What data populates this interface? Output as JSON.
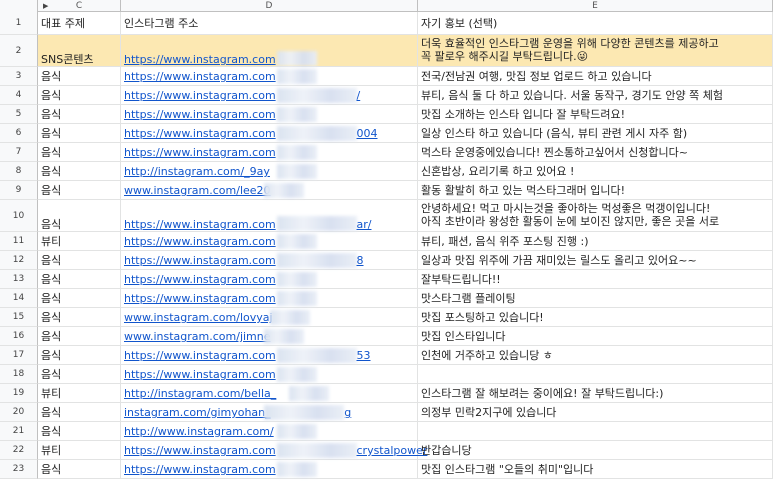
{
  "columns": [
    "C",
    "D",
    "E"
  ],
  "header": {
    "c": "대표 주제",
    "d": "인스타그램 주소",
    "e": "자기 홍보 (선택)"
  },
  "rows": [
    {
      "num": "2",
      "topic": "SNS콘텐츠",
      "url": "https://www.instagram.com",
      "promo": "더욱 효율적인 인스타그램 운영을 위해 다양한 콘텐츠를 제공하고",
      "promo2": "꼭 팔로우 해주시길 부탁드립니다.😜"
    },
    {
      "num": "3",
      "topic": "음식",
      "url": "https://www.instagram.com",
      "promo": "전국/전남권 여행, 맛집 정보 업로드 하고 있습니다"
    },
    {
      "num": "4",
      "topic": "음식",
      "url": "https://www.instagram.com",
      "url_suffix": "/",
      "promo": "뷰티, 음식 둘 다 하고 있습니다. 서울 동작구, 경기도 안양 쪽 체험"
    },
    {
      "num": "5",
      "topic": "음식",
      "url": "https://www.instagram.com",
      "promo": "맛집 소개하는 인스타 입니다 잘 부탁드려요!"
    },
    {
      "num": "6",
      "topic": "음식",
      "url": "https://www.instagram.com",
      "url_suffix": "004",
      "promo": "일상 인스타 하고 있습니다 (음식, 뷰티 관련 게시 자주 함)"
    },
    {
      "num": "7",
      "topic": "음식",
      "url": "https://www.instagram.com",
      "promo": "먹스타 운영중에있습니다! 찐소통하고싶어서 신청합니다~"
    },
    {
      "num": "8",
      "topic": "음식",
      "url": "http://instagram.com/_9ay",
      "promo": "신혼밥상, 요리기록 하고 있어요 !"
    },
    {
      "num": "9",
      "topic": "음식",
      "url": "www.instagram.com/lee20",
      "promo": "활동 활발히 하고 있는 먹스타그래머 입니다!"
    },
    {
      "num": "10",
      "topic": "음식",
      "url": "https://www.instagram.com",
      "url_suffix": "ar/",
      "promo": "안녕하세요! 먹고 마시는것을 좋아하는 먹성좋은 먹갱이입니다!",
      "promo2": "아직 초반이라 왕성한 활동이 눈에 보이진 않지만, 좋은 곳을 서로"
    },
    {
      "num": "11",
      "topic": "뷰티",
      "url": "https://www.instagram.com",
      "promo": "뷰티, 패션, 음식 위주 포스팅 진행 :)"
    },
    {
      "num": "12",
      "topic": "음식",
      "url": "https://www.instagram.com",
      "url_suffix": "8",
      "promo": "일상과 맛집 위주에 가끔 재미있는 릴스도 올리고 있어요~~"
    },
    {
      "num": "13",
      "topic": "음식",
      "url": "https://www.instagram.com",
      "promo": "잘부탁드립니다!!"
    },
    {
      "num": "14",
      "topic": "음식",
      "url": "https://www.instagram.com",
      "promo": "맛스타그램 플레이팅"
    },
    {
      "num": "15",
      "topic": "음식",
      "url": "www.instagram.com/lovyaj",
      "promo": "맛집 포스팅하고 있습니다!"
    },
    {
      "num": "16",
      "topic": "음식",
      "url": "www.instagram.com/jimne",
      "promo": "맛집 인스타입니다"
    },
    {
      "num": "17",
      "topic": "음식",
      "url": "https://www.instagram.com",
      "url_suffix": "53",
      "promo": "인천에 거주하고 있습니당 ㅎ"
    },
    {
      "num": "18",
      "topic": "음식",
      "url": "https://www.instagram.com",
      "promo": ""
    },
    {
      "num": "19",
      "topic": "뷰티",
      "url": "http://instagram.com/bella_",
      "promo": "인스타그램 잘 해보려는 중이에요! 잘 부탁드립니다:)"
    },
    {
      "num": "20",
      "topic": "음식",
      "url": "instagram.com/gimyohan_",
      "url_suffix": "g",
      "promo": "의정부 민락2지구에 있습니다"
    },
    {
      "num": "21",
      "topic": "음식",
      "url": "http://www.instagram.com/",
      "promo": ""
    },
    {
      "num": "22",
      "topic": "뷰티",
      "url": "https://www.instagram.com",
      "url_suffix": "crystalpower",
      "promo": "반갑습니당"
    },
    {
      "num": "23",
      "topic": "음식",
      "url": "https://www.instagram.com",
      "promo": "맛집 인스타그램 \"오들의 취미\"입니다"
    }
  ],
  "colors": {
    "highlight_row": "#fce8b2",
    "link": "#1155cc"
  }
}
